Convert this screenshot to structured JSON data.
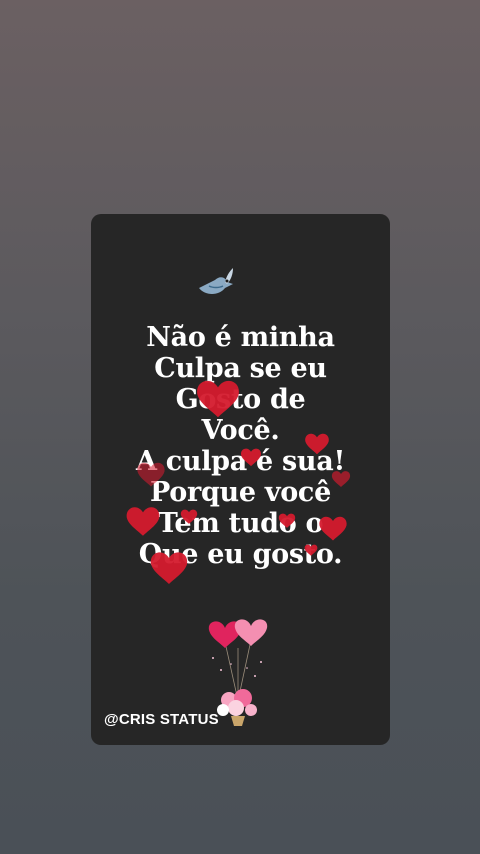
{
  "card": {
    "quote_lines": [
      "Não é minha",
      "Culpa se eu",
      "Gosto de",
      "Você.",
      "A culpa é sua!",
      "Porque você",
      "Tem tudo o",
      "Que eu gosto."
    ],
    "watermark": "@CRIS STATUS",
    "decorations": [
      "bird-icon",
      "floating-hearts",
      "heart-balloon-bouquet"
    ]
  },
  "colors": {
    "card_background": "#262626",
    "text": "#ffffff",
    "heart": "#d41b2e",
    "balloon_pink": "#f06a9a"
  }
}
